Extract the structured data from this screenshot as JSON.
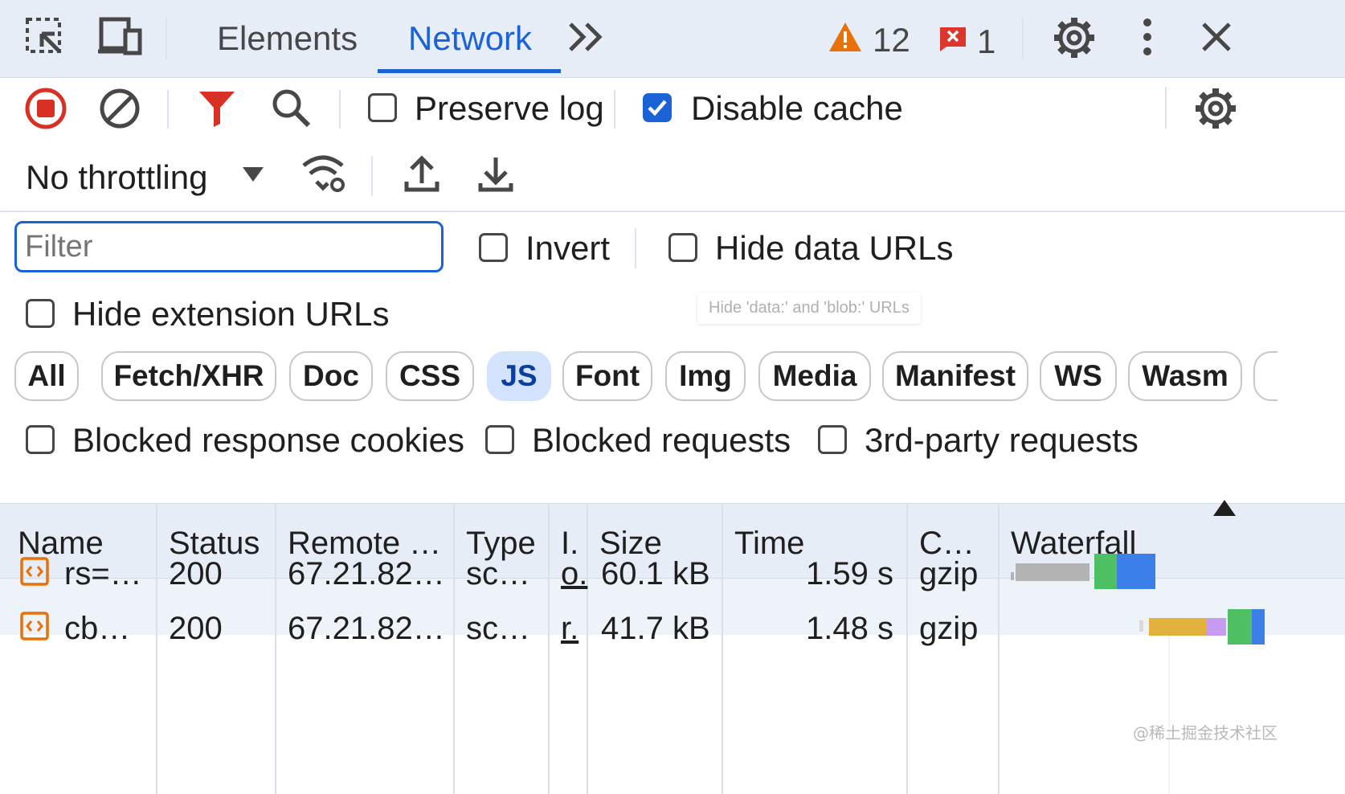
{
  "tabs": {
    "elements": "Elements",
    "network": "Network",
    "more": "»",
    "warnings_count": "12",
    "errors_count": "1"
  },
  "toolbar": {
    "preserve_log": "Preserve log",
    "disable_cache": "Disable cache",
    "disable_cache_checked": true,
    "preserve_log_checked": false,
    "throttling": "No throttling"
  },
  "filter": {
    "placeholder": "Filter",
    "invert": "Invert",
    "hide_data_urls": "Hide data URLs",
    "hide_extension_urls": "Hide extension URLs",
    "tooltip": "Hide 'data:' and 'blob:' URLs"
  },
  "type_filters": [
    "All",
    "Fetch/XHR",
    "Doc",
    "CSS",
    "JS",
    "Font",
    "Img",
    "Media",
    "Manifest",
    "WS",
    "Wasm"
  ],
  "active_type": "JS",
  "options": {
    "blocked_cookies": "Blocked response cookies",
    "blocked_requests": "Blocked requests",
    "third_party": "3rd-party requests"
  },
  "columns": {
    "name": "Name",
    "status": "Status",
    "remote": "Remote …",
    "type": "Type",
    "initiator": "I.",
    "size": "Size",
    "time": "Time",
    "content_encoding": "C…",
    "waterfall": "Waterfall"
  },
  "rows": [
    {
      "name": "rs=…",
      "status": "200",
      "remote": "67.21.82…",
      "type": "sc…",
      "initiator": "o.",
      "size": "60.1 kB",
      "time": "1.59 s",
      "encoding": "gzip"
    },
    {
      "name": "cb…",
      "status": "200",
      "remote": "67.21.82…",
      "type": "sc…",
      "initiator": "r.",
      "size": "41.7 kB",
      "time": "1.48 s",
      "encoding": "gzip"
    }
  ],
  "watermark": "@稀土掘金技术社区",
  "colors": {
    "accent": "#1a62d6",
    "record": "#d93025",
    "warning": "#e8710a",
    "waterfall_gray": "#b3b3b3",
    "waterfall_green": "#4fbf63",
    "waterfall_blue": "#3c7fe8",
    "waterfall_orange": "#e3b23c",
    "waterfall_purple": "#c79bf2"
  }
}
